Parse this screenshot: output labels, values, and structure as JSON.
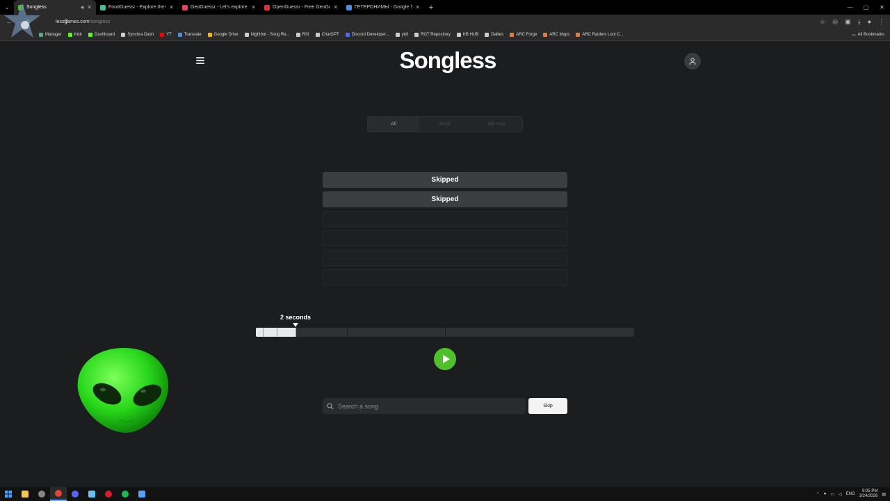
{
  "browser": {
    "tabs": [
      {
        "title": "Songless",
        "active": true,
        "favicon_color": "#4fbf2c",
        "audio": true
      },
      {
        "title": "FoodGuessr - Explore the world",
        "favicon_color": "#3cc0a0"
      },
      {
        "title": "GeoGuessr - Let's explore the world",
        "favicon_color": "#e0445a"
      },
      {
        "title": "OpenGuessr - Free GeoGuessr",
        "favicon_color": "#d33"
      },
      {
        "title": "ГЕТЕРОНИМЫ - Google Search",
        "favicon_color": "#4a90e2"
      }
    ],
    "new_tab_symbol": "+",
    "url_host": "lessgames.com",
    "url_path": "/songless",
    "bookmarks": [
      {
        "label": "Manager",
        "color": "#5a8"
      },
      {
        "label": "Kick",
        "color": "#53fc18"
      },
      {
        "label": "Dashboard",
        "color": "#53fc18"
      },
      {
        "label": "Synchra Dash",
        "color": "#ccc"
      },
      {
        "label": "YT",
        "color": "#f00"
      },
      {
        "label": "Translate",
        "color": "#4a90e2"
      },
      {
        "label": "Google Drive",
        "color": "#f4b400"
      },
      {
        "label": "Nightbot - Song Re...",
        "color": "#ccc"
      },
      {
        "label": "RSI",
        "color": "#ccc"
      },
      {
        "label": "ChatGPT",
        "color": "#ccc"
      },
      {
        "label": "Discord Developer...",
        "color": "#5865f2"
      },
      {
        "label": "ytdl",
        "color": "#ccc"
      },
      {
        "label": "RGT Repository",
        "color": "#ccc"
      },
      {
        "label": "KB HUB",
        "color": "#ccc"
      },
      {
        "label": "Dailies",
        "color": "#ccc"
      },
      {
        "label": "ARC Forge",
        "color": "#e07b39"
      },
      {
        "label": "ARC Maps",
        "color": "#e07b39"
      },
      {
        "label": "ARC Raiders Loot C...",
        "color": "#e07b39"
      }
    ],
    "all_bookmarks_label": "All Bookmarks"
  },
  "app": {
    "logo": "Songless",
    "genres": [
      "All",
      "Rock",
      "Hip Hop"
    ],
    "selected_genre": "All",
    "guesses": [
      "Skipped",
      "Skipped",
      "",
      "",
      "",
      ""
    ],
    "seconds_label": "2 seconds",
    "progress_fraction": 0.105,
    "segment_fractions": [
      0.0184,
      0.0552,
      0.1048,
      0.2408,
      0.5
    ],
    "search_placeholder": "Search a song",
    "skip_label": "Skip",
    "accent_color": "#4fbf2c"
  },
  "taskbar": {
    "lang": "ENG",
    "time": "9:05 PM",
    "date": "3/24/2026"
  }
}
